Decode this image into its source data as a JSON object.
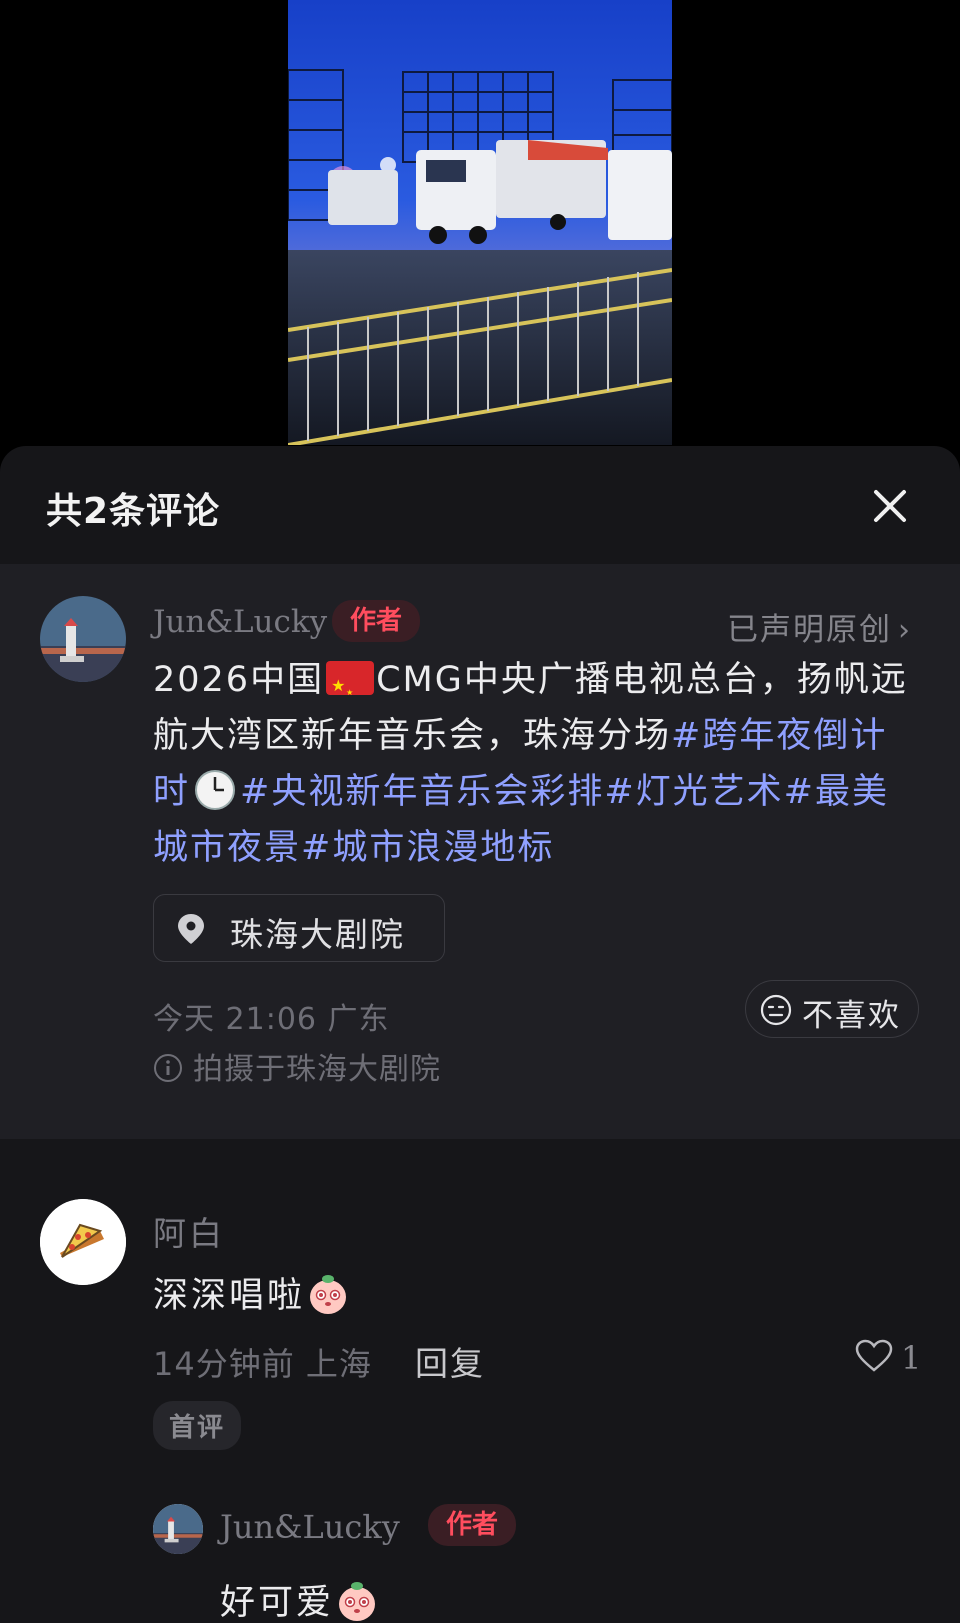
{
  "sheet": {
    "title": "共2条评论"
  },
  "post": {
    "author": "Jun&Lucky",
    "author_badge": "作者",
    "original_label": "已声明原创",
    "text_prefix": "2026中国",
    "text_a": "CMG中央广播电视总台，扬帆远航大湾区新年音乐会，珠海分场",
    "tag_1": "#跨年夜倒计时",
    "tag_2": "#央视新年音乐会彩排",
    "tag_3": "#灯光艺术",
    "tag_4": "#最美城市夜景",
    "tag_5": "#城市浪漫地标",
    "location": "珠海大剧院",
    "time_region": "今天 21:06 广东",
    "shot_at": "拍摄于珠海大剧院",
    "dislike_label": "不喜欢"
  },
  "comment": {
    "author": "阿白",
    "text": "深深唱啦",
    "time_region": "14分钟前 上海",
    "reply_label": "回复",
    "likes": "1",
    "first_badge": "首评"
  },
  "reply": {
    "author": "Jun&Lucky",
    "author_badge": "作者",
    "text": "好可爱"
  },
  "icons": [
    "close-icon",
    "location-pin-icon",
    "info-icon",
    "neutral-face-icon",
    "heart-icon",
    "chevron-right-icon",
    "clock-emoji",
    "china-flag-emoji",
    "peach-emoji",
    "pizza-icon"
  ],
  "colors": {
    "background": "#000000",
    "sheet": "#161619",
    "post_bg": "#1f1f24",
    "hashtag": "#8fa0ff",
    "author_badge": "#ff4d5e"
  }
}
